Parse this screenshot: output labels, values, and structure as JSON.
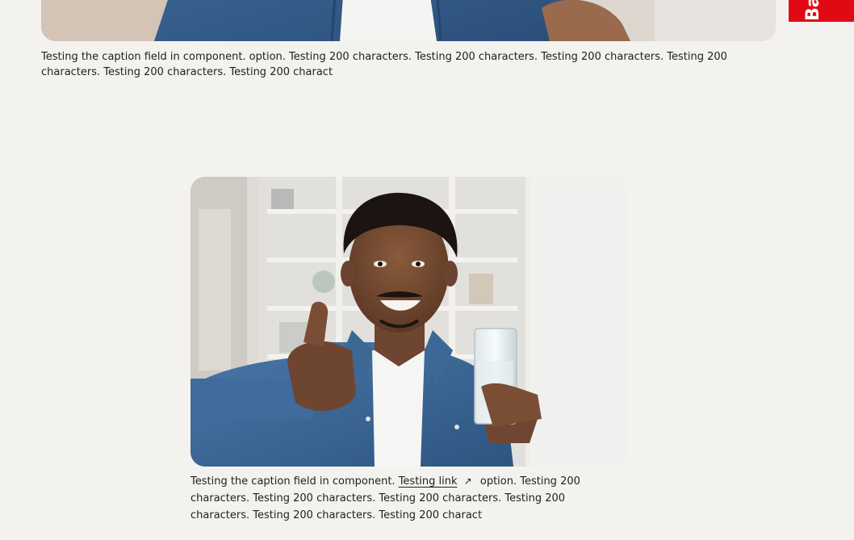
{
  "figures": [
    {
      "image": {
        "alt": "",
        "subject": "man in denim shirt (cropped)"
      },
      "caption": "Testing the caption field in component. option. Testing 200 characters. Testing 200 characters. Testing 200 characters. Testing 200 characters. Testing 200 characters. Testing 200 charact"
    },
    {
      "image": {
        "alt": "",
        "subject": "smiling man giving thumbs up holding a glass of water"
      },
      "caption_before_link": "Testing the caption field in component.",
      "link_text": "Testing link",
      "link_icon": "external-link-icon",
      "caption_after_link": "option. Testing 200 characters. Testing 200 characters. Testing 200 characters. Testing 200 characters. Testing 200 characters. Testing 200 charact"
    }
  ],
  "side_tab": {
    "label": "Ba",
    "color": "#e10a14"
  },
  "colors": {
    "background": "#f4f2ee",
    "text": "#1f1f1f",
    "accent": "#e10a14"
  }
}
